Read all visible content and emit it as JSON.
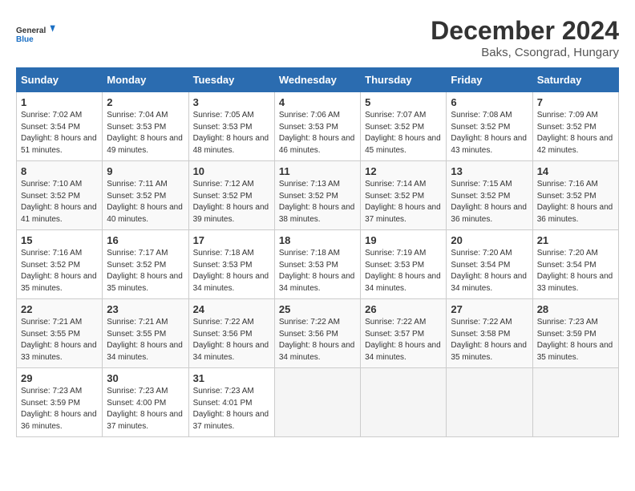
{
  "header": {
    "logo_line1": "General",
    "logo_line2": "Blue",
    "month": "December 2024",
    "location": "Baks, Csongrad, Hungary"
  },
  "days_of_week": [
    "Sunday",
    "Monday",
    "Tuesday",
    "Wednesday",
    "Thursday",
    "Friday",
    "Saturday"
  ],
  "weeks": [
    [
      {
        "day": "1",
        "sunrise": "7:02 AM",
        "sunset": "3:54 PM",
        "daylight": "8 hours and 51 minutes."
      },
      {
        "day": "2",
        "sunrise": "7:04 AM",
        "sunset": "3:53 PM",
        "daylight": "8 hours and 49 minutes."
      },
      {
        "day": "3",
        "sunrise": "7:05 AM",
        "sunset": "3:53 PM",
        "daylight": "8 hours and 48 minutes."
      },
      {
        "day": "4",
        "sunrise": "7:06 AM",
        "sunset": "3:53 PM",
        "daylight": "8 hours and 46 minutes."
      },
      {
        "day": "5",
        "sunrise": "7:07 AM",
        "sunset": "3:52 PM",
        "daylight": "8 hours and 45 minutes."
      },
      {
        "day": "6",
        "sunrise": "7:08 AM",
        "sunset": "3:52 PM",
        "daylight": "8 hours and 43 minutes."
      },
      {
        "day": "7",
        "sunrise": "7:09 AM",
        "sunset": "3:52 PM",
        "daylight": "8 hours and 42 minutes."
      }
    ],
    [
      {
        "day": "8",
        "sunrise": "7:10 AM",
        "sunset": "3:52 PM",
        "daylight": "8 hours and 41 minutes."
      },
      {
        "day": "9",
        "sunrise": "7:11 AM",
        "sunset": "3:52 PM",
        "daylight": "8 hours and 40 minutes."
      },
      {
        "day": "10",
        "sunrise": "7:12 AM",
        "sunset": "3:52 PM",
        "daylight": "8 hours and 39 minutes."
      },
      {
        "day": "11",
        "sunrise": "7:13 AM",
        "sunset": "3:52 PM",
        "daylight": "8 hours and 38 minutes."
      },
      {
        "day": "12",
        "sunrise": "7:14 AM",
        "sunset": "3:52 PM",
        "daylight": "8 hours and 37 minutes."
      },
      {
        "day": "13",
        "sunrise": "7:15 AM",
        "sunset": "3:52 PM",
        "daylight": "8 hours and 36 minutes."
      },
      {
        "day": "14",
        "sunrise": "7:16 AM",
        "sunset": "3:52 PM",
        "daylight": "8 hours and 36 minutes."
      }
    ],
    [
      {
        "day": "15",
        "sunrise": "7:16 AM",
        "sunset": "3:52 PM",
        "daylight": "8 hours and 35 minutes."
      },
      {
        "day": "16",
        "sunrise": "7:17 AM",
        "sunset": "3:52 PM",
        "daylight": "8 hours and 35 minutes."
      },
      {
        "day": "17",
        "sunrise": "7:18 AM",
        "sunset": "3:53 PM",
        "daylight": "8 hours and 34 minutes."
      },
      {
        "day": "18",
        "sunrise": "7:18 AM",
        "sunset": "3:53 PM",
        "daylight": "8 hours and 34 minutes."
      },
      {
        "day": "19",
        "sunrise": "7:19 AM",
        "sunset": "3:53 PM",
        "daylight": "8 hours and 34 minutes."
      },
      {
        "day": "20",
        "sunrise": "7:20 AM",
        "sunset": "3:54 PM",
        "daylight": "8 hours and 34 minutes."
      },
      {
        "day": "21",
        "sunrise": "7:20 AM",
        "sunset": "3:54 PM",
        "daylight": "8 hours and 33 minutes."
      }
    ],
    [
      {
        "day": "22",
        "sunrise": "7:21 AM",
        "sunset": "3:55 PM",
        "daylight": "8 hours and 33 minutes."
      },
      {
        "day": "23",
        "sunrise": "7:21 AM",
        "sunset": "3:55 PM",
        "daylight": "8 hours and 34 minutes."
      },
      {
        "day": "24",
        "sunrise": "7:22 AM",
        "sunset": "3:56 PM",
        "daylight": "8 hours and 34 minutes."
      },
      {
        "day": "25",
        "sunrise": "7:22 AM",
        "sunset": "3:56 PM",
        "daylight": "8 hours and 34 minutes."
      },
      {
        "day": "26",
        "sunrise": "7:22 AM",
        "sunset": "3:57 PM",
        "daylight": "8 hours and 34 minutes."
      },
      {
        "day": "27",
        "sunrise": "7:22 AM",
        "sunset": "3:58 PM",
        "daylight": "8 hours and 35 minutes."
      },
      {
        "day": "28",
        "sunrise": "7:23 AM",
        "sunset": "3:59 PM",
        "daylight": "8 hours and 35 minutes."
      }
    ],
    [
      {
        "day": "29",
        "sunrise": "7:23 AM",
        "sunset": "3:59 PM",
        "daylight": "8 hours and 36 minutes."
      },
      {
        "day": "30",
        "sunrise": "7:23 AM",
        "sunset": "4:00 PM",
        "daylight": "8 hours and 37 minutes."
      },
      {
        "day": "31",
        "sunrise": "7:23 AM",
        "sunset": "4:01 PM",
        "daylight": "8 hours and 37 minutes."
      },
      null,
      null,
      null,
      null
    ]
  ]
}
